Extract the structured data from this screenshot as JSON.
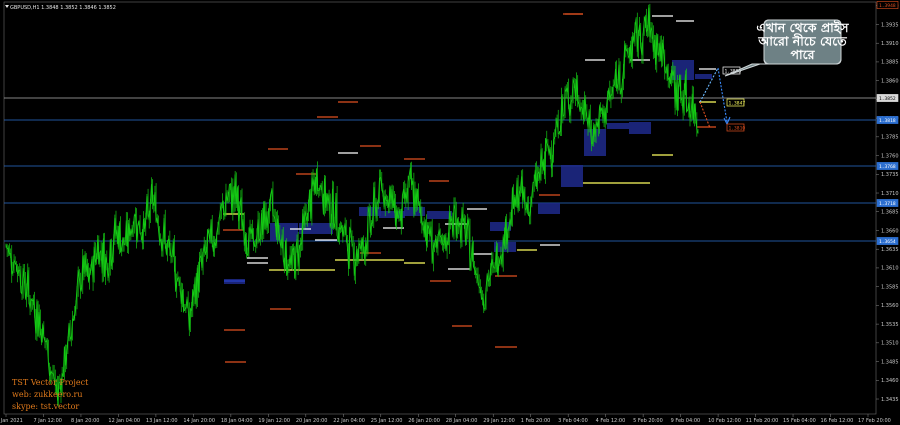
{
  "header": {
    "symbol_line": "GBPUSD,H1  1.3848 1.3852 1.3846 1.3852"
  },
  "watermark": {
    "line1": "TST Vector Project",
    "line2": "web: zukkeero.ru",
    "line3": "skype: tst.vector"
  },
  "callout": {
    "line1": "এখান থেকে প্রাইস",
    "line2": "আরো নীচে যেতে",
    "line3": "পারে"
  },
  "chart_data": {
    "type": "line",
    "series": [
      {
        "name": "GBPUSD H1 close",
        "color": "#14c814"
      }
    ],
    "ylim": [
      1.3415,
      1.3965
    ],
    "y_ticks": [
      "1.3960",
      "1.3935",
      "1.3910",
      "1.3885",
      "1.3860",
      "1.3835",
      "1.3810",
      "1.3785",
      "1.3760",
      "1.3735",
      "1.3710",
      "1.3685",
      "1.3660",
      "1.3635",
      "1.3610",
      "1.3585",
      "1.3560",
      "1.3535",
      "1.3510",
      "1.3485",
      "1.3460",
      "1.3435"
    ],
    "x_ticks": [
      "6 Jan 2021",
      "7 Jan 12:00",
      "8 Jan 20:00",
      "12 Jan 04:00",
      "13 Jan 12:00",
      "14 Jan 20:00",
      "18 Jan 04:00",
      "19 Jan 12:00",
      "20 Jan 20:00",
      "22 Jan 04:00",
      "25 Jan 12:00",
      "26 Jan 20:00",
      "28 Jan 04:00",
      "29 Jan 12:00",
      "1 Feb 20:00",
      "3 Feb 04:00",
      "4 Feb 12:00",
      "5 Feb 20:00",
      "9 Feb 04:00",
      "10 Feb 12:00",
      "11 Feb 20:00",
      "15 Feb 04:00",
      "16 Feb 12:00",
      "17 Feb 20:00"
    ],
    "path_keypoints": [
      [
        0,
        1.364
      ],
      [
        2,
        1.362
      ],
      [
        4,
        1.359
      ],
      [
        6,
        1.356
      ],
      [
        8,
        1.353
      ],
      [
        10,
        1.347
      ],
      [
        11,
        1.344
      ],
      [
        13,
        1.349
      ],
      [
        15,
        1.356
      ],
      [
        17,
        1.361
      ],
      [
        18,
        1.359
      ],
      [
        20,
        1.364
      ],
      [
        22,
        1.362
      ],
      [
        24,
        1.366
      ],
      [
        26,
        1.364
      ],
      [
        28,
        1.368
      ],
      [
        30,
        1.366
      ],
      [
        32,
        1.37
      ],
      [
        34,
        1.366
      ],
      [
        36,
        1.362
      ],
      [
        38,
        1.359
      ],
      [
        40,
        1.354
      ],
      [
        42,
        1.36
      ],
      [
        44,
        1.364
      ],
      [
        46,
        1.366
      ],
      [
        48,
        1.37
      ],
      [
        50,
        1.371
      ],
      [
        52,
        1.366
      ],
      [
        54,
        1.364
      ],
      [
        56,
        1.367
      ],
      [
        58,
        1.369
      ],
      [
        60,
        1.365
      ],
      [
        62,
        1.361
      ],
      [
        64,
        1.364
      ],
      [
        66,
        1.369
      ],
      [
        68,
        1.373
      ],
      [
        70,
        1.37
      ],
      [
        72,
        1.368
      ],
      [
        74,
        1.365
      ],
      [
        76,
        1.363
      ],
      [
        78,
        1.364
      ],
      [
        80,
        1.368
      ],
      [
        82,
        1.372
      ],
      [
        84,
        1.37
      ],
      [
        86,
        1.368
      ],
      [
        88,
        1.372
      ],
      [
        90,
        1.369
      ],
      [
        92,
        1.366
      ],
      [
        94,
        1.363
      ],
      [
        96,
        1.365
      ],
      [
        98,
        1.368
      ],
      [
        100,
        1.366
      ],
      [
        102,
        1.362
      ],
      [
        104,
        1.358
      ],
      [
        106,
        1.36
      ],
      [
        108,
        1.364
      ],
      [
        110,
        1.368
      ],
      [
        112,
        1.371
      ],
      [
        114,
        1.369
      ],
      [
        116,
        1.373
      ],
      [
        118,
        1.376
      ],
      [
        120,
        1.379
      ],
      [
        122,
        1.383
      ],
      [
        124,
        1.385
      ],
      [
        126,
        1.382
      ],
      [
        128,
        1.379
      ],
      [
        130,
        1.381
      ],
      [
        132,
        1.384
      ],
      [
        134,
        1.387
      ],
      [
        136,
        1.39
      ],
      [
        138,
        1.392
      ],
      [
        140,
        1.393
      ],
      [
        142,
        1.391
      ],
      [
        144,
        1.388
      ],
      [
        146,
        1.385
      ],
      [
        148,
        1.384
      ],
      [
        150,
        1.382
      ],
      [
        151,
        1.381
      ]
    ]
  },
  "right_axis_labels": {
    "top_box": "1.3948",
    "box1": "1.3852",
    "box2": "1.3818",
    "box3": "1.3768",
    "box4": "1.3718",
    "box5": "1.3654"
  },
  "price_marks": {
    "white": "1.3893",
    "yellow": "1.3847",
    "red": "1.3810"
  }
}
